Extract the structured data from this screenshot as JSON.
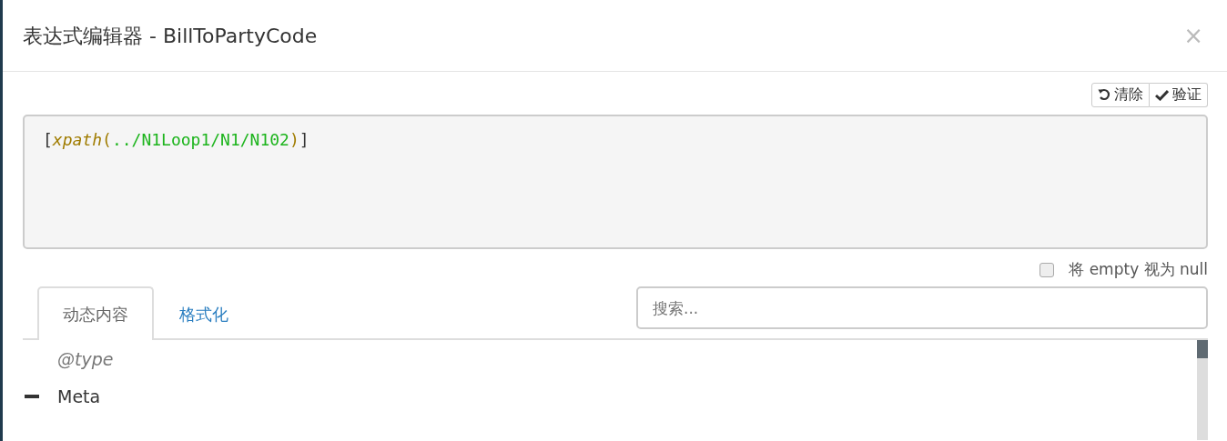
{
  "dialog": {
    "title": "表达式编辑器 - BillToPartyCode",
    "close": "×"
  },
  "toolbar": {
    "buttons": [
      {
        "kind": "undo",
        "label": "清除"
      },
      {
        "kind": "check",
        "label": "验证"
      }
    ]
  },
  "expression": {
    "tokens": [
      {
        "kind": "bracket",
        "text": "["
      },
      {
        "kind": "function",
        "text": "xpath"
      },
      {
        "kind": "paren",
        "text": "("
      },
      {
        "kind": "path",
        "text": "../N1Loop1/N1/N102"
      },
      {
        "kind": "paren",
        "text": ")"
      },
      {
        "kind": "bracket",
        "text": "]"
      }
    ]
  },
  "empty_as_null": {
    "label": "将 empty 视为 null",
    "checked": false
  },
  "tabs": [
    {
      "label": "动态内容",
      "selected": true
    },
    {
      "label": "格式化",
      "selected": false
    }
  ],
  "search": {
    "placeholder": "搜索..."
  },
  "tree": [
    {
      "kind": "attribute",
      "label": "@type"
    },
    {
      "kind": "node",
      "label": "Meta",
      "expanded": true
    }
  ]
}
